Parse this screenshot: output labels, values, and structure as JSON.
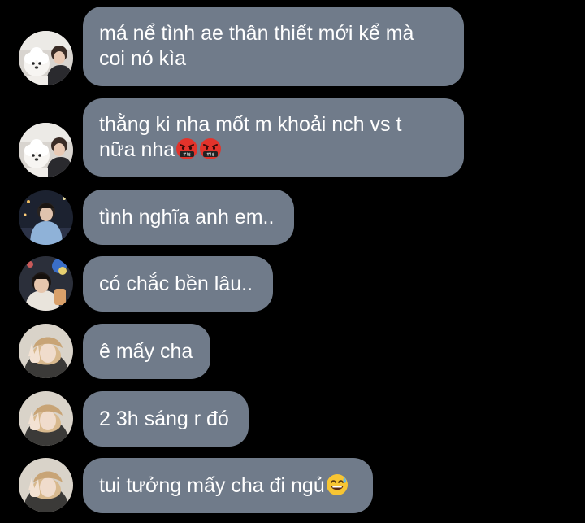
{
  "messages": [
    {
      "avatar": "avatar-boy-with-dog-icon",
      "lines": [
        "má nể tình ae thân thiết mới kể mà",
        "coi nó kìa"
      ],
      "emojis": []
    },
    {
      "avatar": "avatar-boy-with-dog-icon",
      "lines": [
        "thằng ki nha mốt m khoải nch vs t",
        "nữa nha"
      ],
      "emojis": [
        "face-with-symbols-on-mouth-emoji",
        "face-with-symbols-on-mouth-emoji"
      ]
    },
    {
      "avatar": "avatar-boy-blue-hoodie-icon",
      "lines": [
        "tình nghĩa anh em.."
      ],
      "emojis": []
    },
    {
      "avatar": "avatar-boy-night-selfie-icon",
      "lines": [
        "có chắc bền lâu.."
      ],
      "emojis": []
    },
    {
      "avatar": "avatar-girl-peace-sign-icon",
      "lines": [
        "ê mấy cha"
      ],
      "emojis": []
    },
    {
      "avatar": "avatar-girl-peace-sign-icon",
      "lines": [
        "2 3h sáng r đó"
      ],
      "emojis": []
    },
    {
      "avatar": "avatar-girl-peace-sign-icon",
      "lines": [
        "tui tưởng mấy cha đi ngủ"
      ],
      "emojis": [
        "grinning-face-with-sweat-emoji"
      ]
    }
  ],
  "colors": {
    "background": "#000000",
    "bubble": "#707b8a",
    "text": "#ffffff"
  }
}
